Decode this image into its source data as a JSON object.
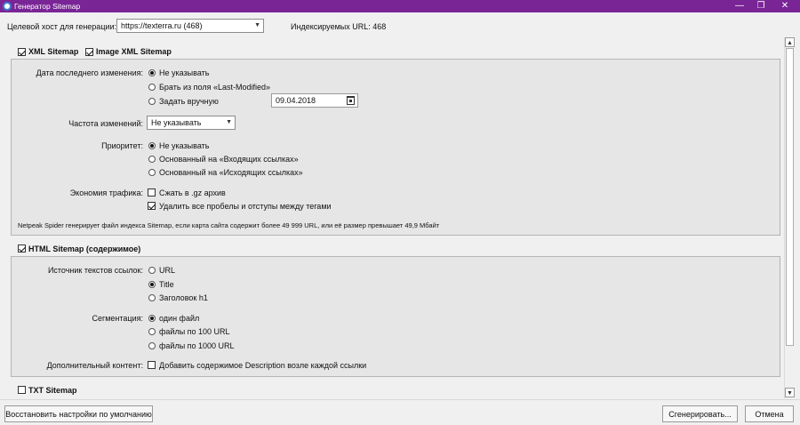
{
  "window": {
    "title": "Генератор Sitemap",
    "title_color": "#7a2596",
    "controls": {
      "minimize": "—",
      "restore": "❐",
      "close": "✕"
    }
  },
  "top": {
    "host_label": "Целевой хост для генерации:",
    "host_value": "https://texterra.ru (468)",
    "indexed_text": "Индексируемых URL: 468"
  },
  "xml": {
    "section_xml_label": "XML Sitemap",
    "section_image_label": "Image XML Sitemap",
    "lastmod_label": "Дата последнего изменения:",
    "lastmod_options": [
      "Не указывать",
      "Брать из поля «Last-Modified»",
      "Задать вручную"
    ],
    "date_value": "09.04.2018",
    "freq_label": "Частота изменений:",
    "freq_value": "Не указывать",
    "priority_label": "Приоритет:",
    "priority_options": [
      "Не указывать",
      "Основанный на «Входящих ссылках»",
      "Основанный на «Исходящих ссылках»"
    ],
    "economy_label": "Экономия трафика:",
    "economy_options": [
      "Сжать в .gz архив",
      "Удалить все пробелы и отступы между тегами"
    ],
    "note": "Netpeak Spider генерирует файл индекса Sitemap, если карта сайта содержит более 49 999 URL, или её размер превышает 49,9 Мбайт"
  },
  "html": {
    "section_label": "HTML Sitemap (содержимое)",
    "source_label": "Источник текстов ссылок:",
    "source_options": [
      "URL",
      "Title",
      "Заголовок h1"
    ],
    "segmentation_label": "Сегментация:",
    "segmentation_options": [
      "один файл",
      "файлы по 100 URL",
      "файлы по 1000 URL"
    ],
    "extra_label": "Дополнительный контент:",
    "extra_option": "Добавить содержимое Description возле каждой ссылки"
  },
  "txt": {
    "section_label": "TXT Sitemap"
  },
  "scrollbar": {
    "up": "▲",
    "down": "▼"
  },
  "buttons": {
    "restore_defaults": "Восстановить настройки по умолчанию",
    "generate": "Сгенерировать...",
    "cancel": "Отмена"
  }
}
